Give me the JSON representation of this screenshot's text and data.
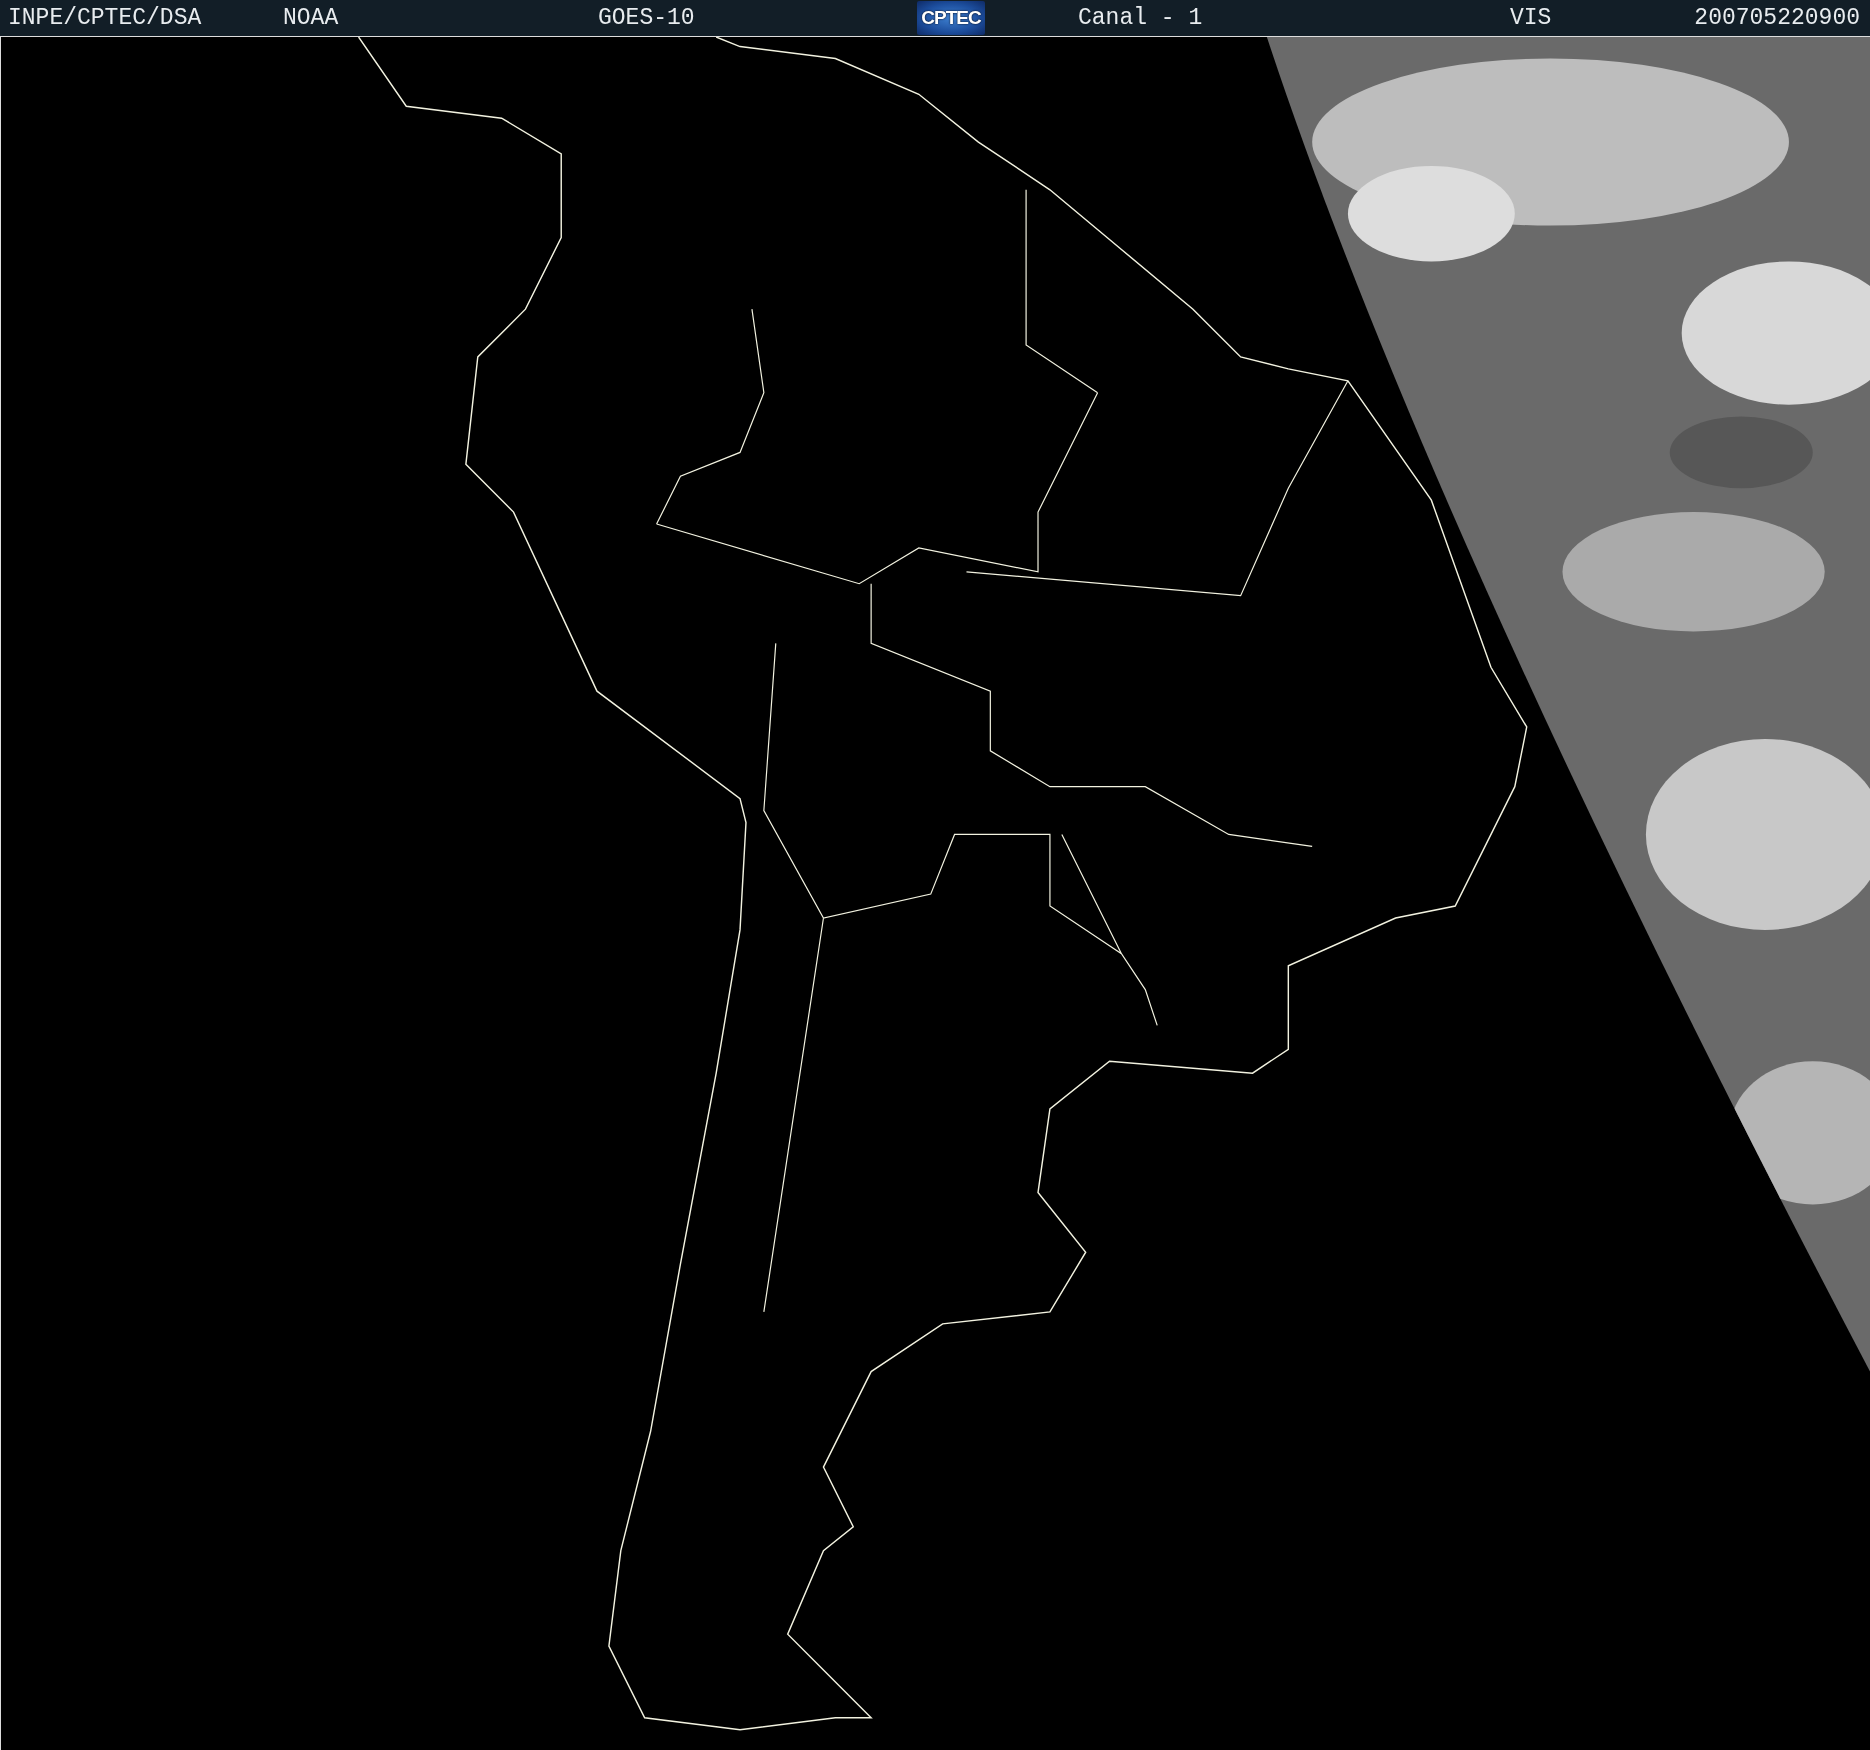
{
  "header": {
    "source": "INPE/CPTEC/DSA",
    "agency": "NOAA",
    "satellite": "GOES-10",
    "logo": "CPTEC",
    "channel": "Canal - 1",
    "band": "VIS",
    "timestamp": "200705220900"
  }
}
